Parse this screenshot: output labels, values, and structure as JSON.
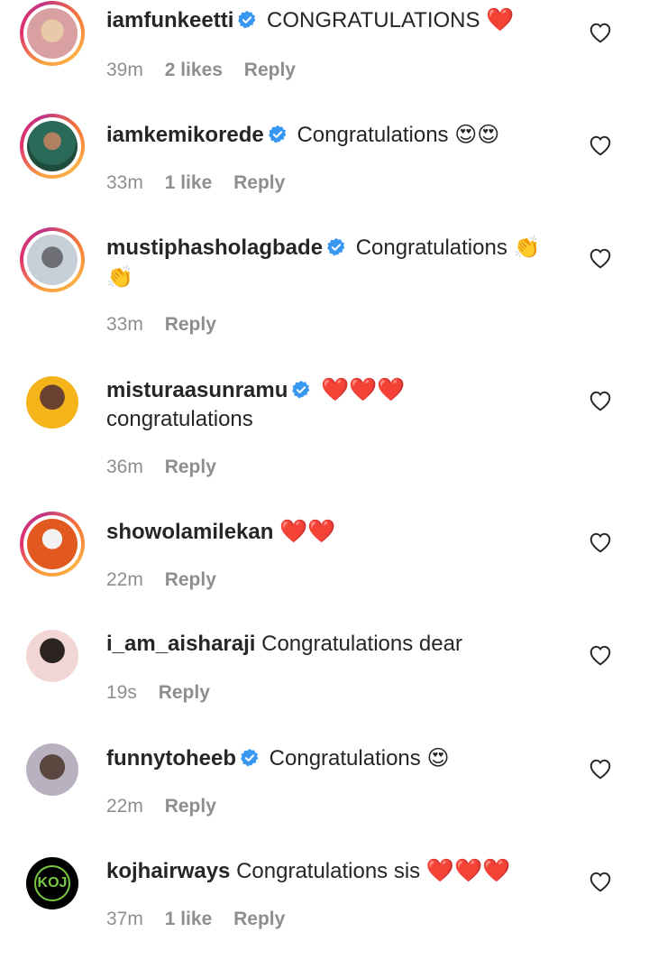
{
  "comments": [
    {
      "username": "iamfunkeetti",
      "verified": true,
      "text": "CONGRATULATIONS",
      "emoji": "❤️",
      "time": "39m",
      "likes": "2 likes",
      "reply": "Reply",
      "avatar_colors": [
        "#e8c9a8",
        "#d8a0a0"
      ]
    },
    {
      "username": "iamkemikorede",
      "verified": true,
      "text": "Congratulations",
      "emoji": "😍😍",
      "time": "33m",
      "likes": "1 like",
      "reply": "Reply",
      "avatar_colors": [
        "#2a6a58",
        "#1e4d3e"
      ]
    },
    {
      "username": "mustiphasholagbade",
      "verified": true,
      "text": "Congratulations",
      "emoji": "👏",
      "emoji_line2": "👏",
      "time": "33m",
      "reply": "Reply",
      "avatar_colors": [
        "#c7d0d8",
        "#6d6f75"
      ]
    },
    {
      "username": "misturaasunramu",
      "verified": true,
      "text": "congratulations",
      "emoji": "❤️❤️❤️",
      "time": "36m",
      "reply": "Reply",
      "avatar_colors": [
        "#f4b41a",
        "#6a4030"
      ]
    },
    {
      "username": "showolamilekan",
      "verified": false,
      "text": "",
      "emoji": "❤️❤️",
      "time": "22m",
      "reply": "Reply",
      "avatar_colors": [
        "#e2591f",
        "#f2f2f2"
      ]
    },
    {
      "username": "i_am_aisharaji",
      "verified": false,
      "text": "Congratulations dear",
      "emoji": "",
      "time": "19s",
      "reply": "Reply",
      "avatar_colors": [
        "#f2d6d6",
        "#2b2320"
      ]
    },
    {
      "username": "funnytoheeb",
      "verified": true,
      "text": "Congratulations",
      "emoji": "😍",
      "time": "22m",
      "reply": "Reply",
      "avatar_colors": [
        "#b8b2c0",
        "#5b4640"
      ]
    },
    {
      "username": "kojhairways",
      "verified": false,
      "text": "Congratulations sis",
      "emoji": "❤️❤️❤️",
      "time": "37m",
      "likes": "1 like",
      "reply": "Reply",
      "avatar_label": "KOJ",
      "avatar_colors": [
        "#000000",
        "#7ac943"
      ]
    }
  ],
  "colors": {
    "verified_badge": "#3897f0",
    "meta_text": "#8e8e8e",
    "heart": "#e0161f"
  }
}
